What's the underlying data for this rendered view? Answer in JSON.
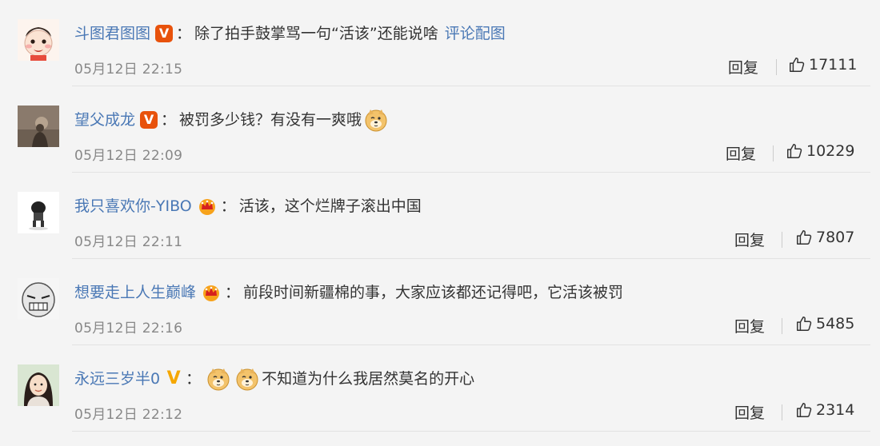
{
  "comments": [
    {
      "username": "斗图君图图",
      "badge": "orange-v-badge",
      "colon": "：",
      "content": "除了拍手鼓掌骂一句“活该”还能说啥",
      "link": "评论配图",
      "time": "05月12日 22:15",
      "reply": "回复",
      "likes": "17111"
    },
    {
      "username": "望父成龙",
      "badge": "orange-v-badge",
      "colon": "：",
      "content": "被罚多少钱？有没有一爽哦",
      "emoji": "doge-emoji",
      "time": "05月12日 22:09",
      "reply": "回复",
      "likes": "10229"
    },
    {
      "username": "我只喜欢你-YIBO",
      "badge": "crown-badge",
      "colon": "：",
      "content": "活该，这个烂牌子滚出中国",
      "time": "05月12日 22:11",
      "reply": "回复",
      "likes": "7807"
    },
    {
      "username": "想要走上人生巅峰",
      "badge": "crown-badge",
      "colon": "：",
      "content": "前段时间新疆棉的事，大家应该都还记得吧，它活该被罚",
      "time": "05月12日 22:16",
      "reply": "回复",
      "likes": "5485"
    },
    {
      "username": "永远三岁半0",
      "badge": "yellow-v-badge",
      "colon": "：",
      "content": "不知道为什么我居然莫名的开心",
      "emoji": "doge-emoji",
      "time": "05月12日 22:12",
      "reply": "回复",
      "likes": "2314"
    }
  ],
  "icons": {
    "like": "thumbs-up-icon",
    "crown": "crown-icon"
  },
  "colors": {
    "username": "#4a78b5",
    "orange_v": "#e8520c",
    "yellow_v": "#f5a700",
    "time": "#888888"
  }
}
